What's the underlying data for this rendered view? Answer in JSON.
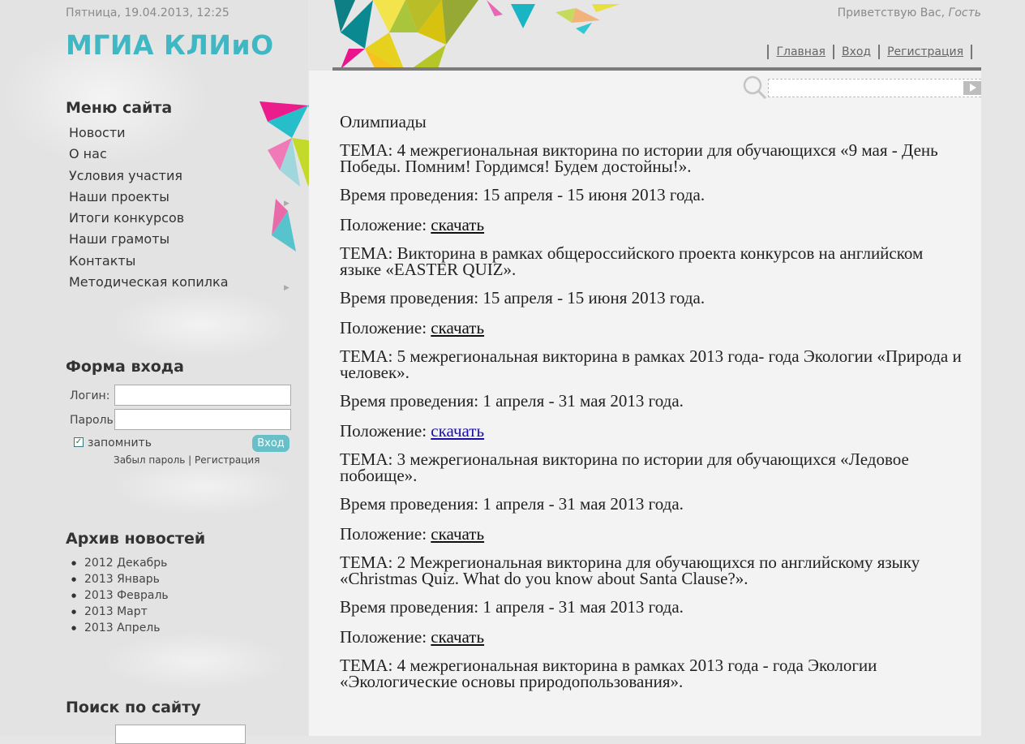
{
  "header": {
    "date": "Пятница, 19.04.2013, 12:25",
    "logo": "МГИА КЛИиО",
    "greeting_prefix": "Приветствую Вас,",
    "greeting_user": "Гость",
    "nav": [
      "Главная",
      "Вход",
      "Регистрация"
    ]
  },
  "sidebar": {
    "menu_title": "Меню сайта",
    "menu": [
      "Новости",
      "О нас",
      "Условия участия",
      "Наши проекты",
      "Итоги конкурсов",
      "Наши грамоты",
      "Контакты",
      "Методическая копилка"
    ],
    "login": {
      "title": "Форма входа",
      "login_label": "Логин:",
      "password_label": "Пароль:",
      "remember_label": "запомнить",
      "remember_checked": true,
      "submit_label": "Вход",
      "forgot_label": "Забыл пароль",
      "register_label": "Регистрация"
    },
    "archive_title": "Архив новостей",
    "archive": [
      "2012 Декабрь",
      "2013 Январь",
      "2013 Февраль",
      "2013 Март",
      "2013 Апрель"
    ],
    "site_search_title": "Поиск по сайту"
  },
  "content": {
    "heading": "Олимпиады",
    "items": [
      {
        "topic": "ТЕМА: 4 межрегиональная викторина по истории для обучающихся «9 мая - День Победы. Помним! Гордимся! Будем достойны!».",
        "time": "Время проведения: 15 апреля - 15 июня 2013 года.",
        "doc_prefix": "Положение:",
        "doc_link": "скачать"
      },
      {
        "topic": "ТЕМА: Викторина в рамках общероссийского проекта конкурсов на английском языке «EASTER QUIZ».",
        "time": "Время проведения: 15 апреля - 15 июня 2013 года.",
        "doc_prefix": "Положение:",
        "doc_link": "скачать"
      },
      {
        "topic": "ТЕМА: 5 межрегиональная викторина в рамках 2013 года- года Экологии «Природа и человек».",
        "time": "Время проведения: 1 апреля - 31 мая 2013 года.",
        "doc_prefix": "Положение:",
        "doc_link": "скачать"
      },
      {
        "topic": "ТЕМА: 3 межрегиональная викторина по истории для обучающихся «Ледовое побоище».",
        "time": "Время проведения: 1 апреля - 31 мая 2013 года.",
        "doc_prefix": "Положение:",
        "doc_link": "скачать"
      },
      {
        "topic": "ТЕМА: 2 Межрегиональная викторина для обучающихся по английскому языку «Christmas Quiz. What do you know about Santa Clause?».",
        "time": "Время проведения: 1 апреля - 31 мая 2013 года.",
        "doc_prefix": "Положение:",
        "doc_link": "скачать"
      },
      {
        "topic": "ТЕМА: 4 межрегиональная викторина в рамках 2013 года - года Экологии «Экологические основы природопользования».",
        "time": "",
        "doc_prefix": "",
        "doc_link": ""
      }
    ]
  },
  "colors": {
    "accent": "#3fb8c3",
    "link_visited": "#1a0dab"
  }
}
